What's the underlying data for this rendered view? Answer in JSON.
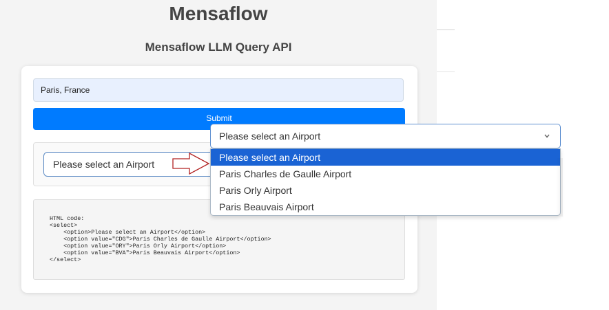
{
  "header": {
    "app_title": "Mensaflow",
    "subtitle": "Mensaflow LLM Query API"
  },
  "form": {
    "query_value": "Paris, France",
    "submit_label": "Submit"
  },
  "result": {
    "select_value": "Please select an Airport"
  },
  "code": {
    "text": "HTML code:\n<select>\n    <option>Please select an Airport</option>\n    <option value=\"CDG\">Paris Charles de Gaulle Airport</option>\n    <option value=\"ORY\">Paris Orly Airport</option>\n    <option value=\"BVA\">Paris Beauvais Airport</option>\n</select>"
  },
  "dropdown": {
    "selected_label": "Please select an Airport",
    "options": [
      "Please select an Airport",
      "Paris Charles de Gaulle Airport",
      "Paris Orly Airport",
      "Paris Beauvais Airport"
    ],
    "highlight_color": "#1a63d4"
  },
  "colors": {
    "accent": "#007bff",
    "input_bg": "#e8f0fe",
    "arrow_stroke": "#b22222"
  },
  "icons": {
    "arrow": "right-arrow-icon",
    "chevron": "chevron-down-icon"
  }
}
